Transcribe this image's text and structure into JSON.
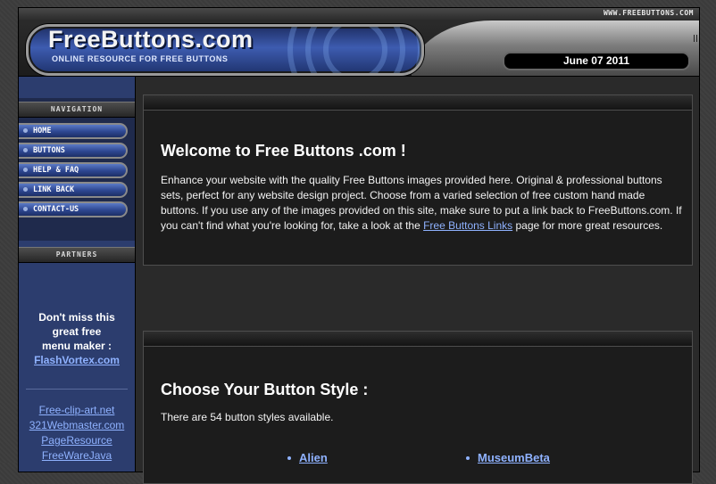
{
  "header": {
    "site_url": "WWW.FREEBUTTONS.COM",
    "logo_text": "FreeButtons.com",
    "tagline": "ONLINE RESOURCE FOR FREE BUTTONS",
    "date": "June 07 2011"
  },
  "sidebar": {
    "nav_heading": "NAVIGATION",
    "nav_items": [
      {
        "label": "HOME"
      },
      {
        "label": "BUTTONS"
      },
      {
        "label": "HELP & FAQ"
      },
      {
        "label": "LINK BACK"
      },
      {
        "label": "CONTACT-US"
      }
    ],
    "partners_heading": "PARTNERS",
    "promo": {
      "line1": "Don't miss this",
      "line2": "great free",
      "line3": "menu maker :",
      "link": "FlashVortex.com"
    },
    "partner_links": [
      "Free-clip-art.net",
      "321Webmaster.com",
      "PageResource",
      "FreeWareJava"
    ]
  },
  "welcome": {
    "title": "Welcome to Free Buttons .com !",
    "body_before": "Enhance your website with the quality Free Buttons images provided here. Original & professional buttons sets, perfect for any website design project. Choose from a varied selection of free custom hand made buttons. If you use any of the images provided on this site, make sure to put a link back to FreeButtons.com. If you can't find what you're looking for, take a look at the ",
    "link": "Free Buttons Links",
    "body_after": " page for more great resources."
  },
  "styles": {
    "title": "Choose Your Button Style :",
    "count_text": "There are 54 button styles available.",
    "items": [
      "Alien",
      "MuseumBeta"
    ]
  },
  "colors": {
    "accent_blue": "#2d4690",
    "link_blue": "#8fb2ff",
    "panel_bg": "#1c1c1c"
  }
}
